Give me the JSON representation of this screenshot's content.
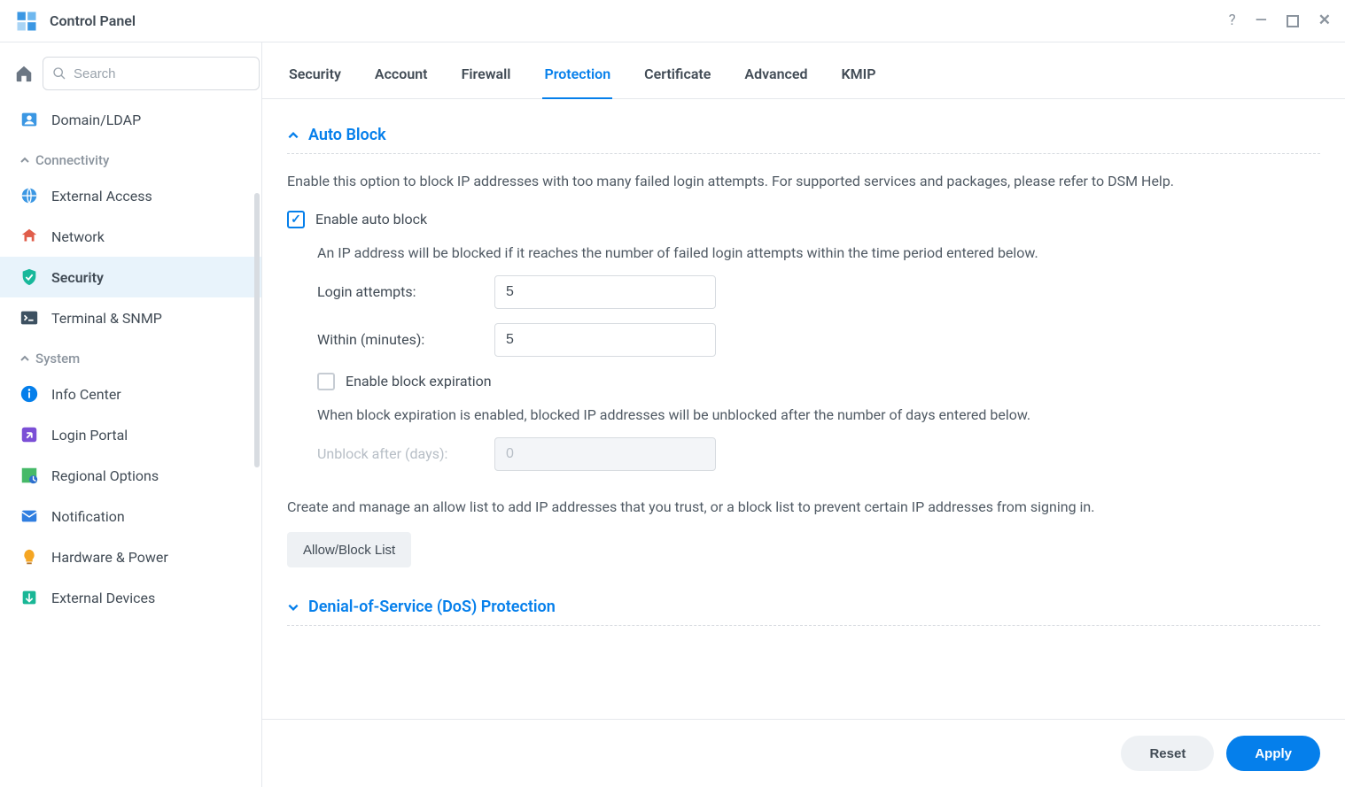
{
  "window": {
    "title": "Control Panel"
  },
  "search": {
    "placeholder": "Search"
  },
  "sidebar": {
    "items": [
      {
        "label": "Domain/LDAP"
      }
    ],
    "sections": {
      "connectivity": {
        "label": "Connectivity",
        "items": [
          {
            "label": "External Access"
          },
          {
            "label": "Network"
          },
          {
            "label": "Security"
          },
          {
            "label": "Terminal & SNMP"
          }
        ]
      },
      "system": {
        "label": "System",
        "items": [
          {
            "label": "Info Center"
          },
          {
            "label": "Login Portal"
          },
          {
            "label": "Regional Options"
          },
          {
            "label": "Notification"
          },
          {
            "label": "Hardware & Power"
          },
          {
            "label": "External Devices"
          }
        ]
      }
    }
  },
  "tabs": {
    "security": "Security",
    "account": "Account",
    "firewall": "Firewall",
    "protection": "Protection",
    "certificate": "Certificate",
    "advanced": "Advanced",
    "kmip": "KMIP"
  },
  "protection": {
    "autoblock": {
      "title": "Auto Block",
      "help": "Enable this option to block IP addresses with too many failed login attempts. For supported services and packages, please refer to DSM Help.",
      "enable_label": "Enable auto block",
      "subdesc": "An IP address will be blocked if it reaches the number of failed login attempts within the time period entered below.",
      "attempts_label": "Login attempts:",
      "attempts_value": "5",
      "within_label": "Within (minutes):",
      "within_value": "5",
      "expire_label": "Enable block expiration",
      "expire_desc": "When block expiration is enabled, blocked IP addresses will be unblocked after the number of days entered below.",
      "unblock_label": "Unblock after (days):",
      "unblock_value": "0",
      "list_desc": "Create and manage an allow list to add IP addresses that you trust, or a block list to prevent certain IP addresses from signing in.",
      "list_btn": "Allow/Block List"
    },
    "dos": {
      "title": "Denial-of-Service (DoS) Protection"
    }
  },
  "footer": {
    "reset": "Reset",
    "apply": "Apply"
  }
}
